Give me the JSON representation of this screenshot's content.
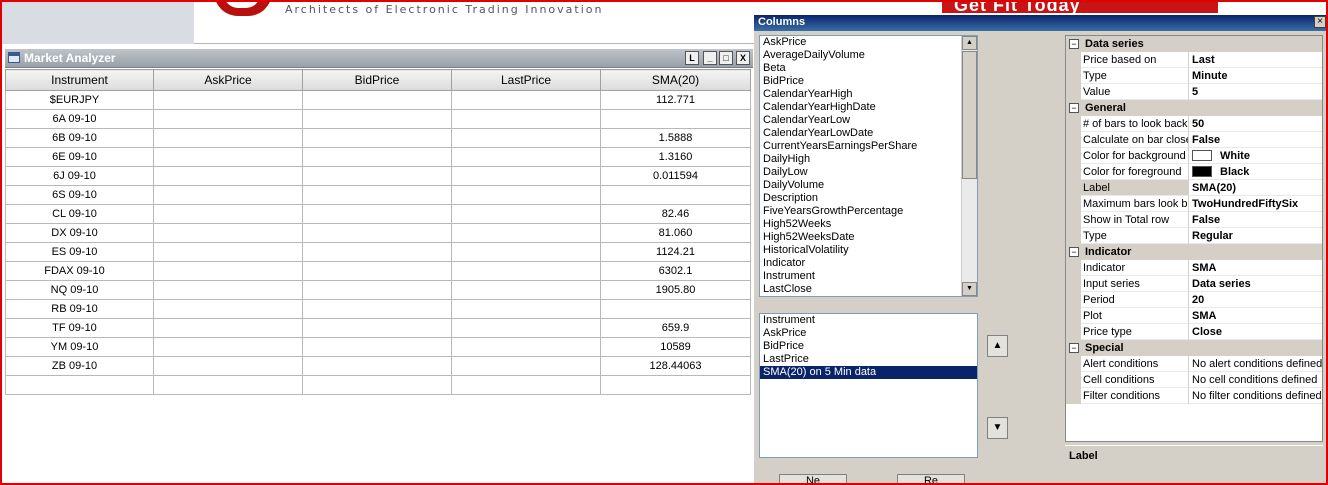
{
  "banner": {
    "tagline": "Architects of Electronic Trading Innovation",
    "brand_fragment": "Get Fit Today"
  },
  "market_analyzer": {
    "title": "Market Analyzer",
    "buttons": {
      "link": "L",
      "minimize": "_",
      "maximize": "□",
      "close": "X"
    },
    "columns": [
      "Instrument",
      "AskPrice",
      "BidPrice",
      "LastPrice",
      "SMA(20)"
    ],
    "rows": [
      {
        "instrument": "$EURJPY",
        "ask": "",
        "bid": "",
        "last": "",
        "sma": "112.771"
      },
      {
        "instrument": "6A 09-10",
        "ask": "",
        "bid": "",
        "last": "",
        "sma": ""
      },
      {
        "instrument": "6B 09-10",
        "ask": "",
        "bid": "",
        "last": "",
        "sma": "1.5888"
      },
      {
        "instrument": "6E 09-10",
        "ask": "",
        "bid": "",
        "last": "",
        "sma": "1.3160"
      },
      {
        "instrument": "6J 09-10",
        "ask": "",
        "bid": "",
        "last": "",
        "sma": "0.011594"
      },
      {
        "instrument": "6S 09-10",
        "ask": "",
        "bid": "",
        "last": "",
        "sma": ""
      },
      {
        "instrument": "CL 09-10",
        "ask": "",
        "bid": "",
        "last": "",
        "sma": "82.46"
      },
      {
        "instrument": "DX 09-10",
        "ask": "",
        "bid": "",
        "last": "",
        "sma": "81.060"
      },
      {
        "instrument": "ES 09-10",
        "ask": "",
        "bid": "",
        "last": "",
        "sma": "1124.21"
      },
      {
        "instrument": "FDAX 09-10",
        "ask": "",
        "bid": "",
        "last": "",
        "sma": "6302.1"
      },
      {
        "instrument": "NQ 09-10",
        "ask": "",
        "bid": "",
        "last": "",
        "sma": "1905.80"
      },
      {
        "instrument": "RB 09-10",
        "ask": "",
        "bid": "",
        "last": "",
        "sma": ""
      },
      {
        "instrument": "TF 09-10",
        "ask": "",
        "bid": "",
        "last": "",
        "sma": "659.9"
      },
      {
        "instrument": "YM 09-10",
        "ask": "",
        "bid": "",
        "last": "",
        "sma": "10589"
      },
      {
        "instrument": "ZB 09-10",
        "ask": "",
        "bid": "",
        "last": "",
        "sma": "128.44063"
      },
      {
        "instrument": "",
        "ask": "",
        "bid": "",
        "last": "",
        "sma": ""
      }
    ]
  },
  "columns_dialog": {
    "title": "Columns",
    "close": "×",
    "available": [
      "AskPrice",
      "AverageDailyVolume",
      "Beta",
      "BidPrice",
      "CalendarYearHigh",
      "CalendarYearHighDate",
      "CalendarYearLow",
      "CalendarYearLowDate",
      "CurrentYearsEarningsPerShare",
      "DailyHigh",
      "DailyLow",
      "DailyVolume",
      "Description",
      "FiveYearsGrowthPercentage",
      "High52Weeks",
      "High52WeeksDate",
      "HistoricalVolatility",
      "Indicator",
      "Instrument",
      "LastClose"
    ],
    "selected": [
      "Instrument",
      "AskPrice",
      "BidPrice",
      "LastPrice",
      "SMA(20) on 5 Min data"
    ],
    "selected_index": 4,
    "move_up": "▲",
    "move_down": "▼",
    "bottom_buttons": [
      "Ne",
      "Re"
    ],
    "properties": {
      "data_series": {
        "label": "Data series",
        "toggle": "−",
        "rows": [
          {
            "name": "Price based on",
            "value": "Last"
          },
          {
            "name": "Type",
            "value": "Minute"
          },
          {
            "name": "Value",
            "value": "5"
          }
        ]
      },
      "general": {
        "label": "General",
        "toggle": "−",
        "rows": [
          {
            "name": "# of bars to look back",
            "value": "50"
          },
          {
            "name": "Calculate on bar close",
            "value": "False"
          },
          {
            "name": "Color for background",
            "value": "White",
            "swatch": "#ffffff"
          },
          {
            "name": "Color for foreground",
            "value": "Black",
            "swatch": "#000000"
          },
          {
            "name": "Label",
            "value": "SMA(20)"
          },
          {
            "name": "Maximum bars look back",
            "value": "TwoHundredFiftySix"
          },
          {
            "name": "Show in Total row",
            "value": "False"
          },
          {
            "name": "Type",
            "value": "Regular"
          }
        ]
      },
      "indicator": {
        "label": "Indicator",
        "toggle": "−",
        "rows": [
          {
            "name": "Indicator",
            "value": "SMA"
          },
          {
            "name": "Input series",
            "value": "Data series"
          },
          {
            "name": "Period",
            "value": "20"
          },
          {
            "name": "Plot",
            "value": "SMA"
          },
          {
            "name": "Price type",
            "value": "Close"
          }
        ]
      },
      "special": {
        "label": "Special",
        "toggle": "−",
        "rows": [
          {
            "name": "Alert conditions",
            "value": "No alert conditions defined"
          },
          {
            "name": "Cell conditions",
            "value": "No cell conditions defined"
          },
          {
            "name": "Filter conditions",
            "value": "No filter conditions defined"
          }
        ]
      }
    },
    "help_title": "Label"
  }
}
